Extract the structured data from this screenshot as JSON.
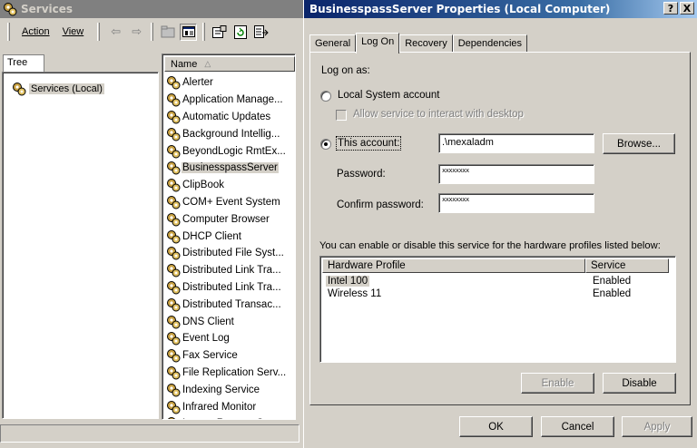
{
  "services_window": {
    "title": "Services",
    "menu": {
      "action": "Action",
      "view": "View"
    },
    "toolbar_icons": [
      "back-arrow-icon",
      "forward-arrow-icon",
      "up-folder-icon",
      "properties-grid-icon",
      "properties-icon",
      "refresh-icon",
      "export-icon"
    ],
    "tree_tab": "Tree",
    "tree_root": "Services (Local)",
    "list_header": "Name",
    "sort_glyph": "△",
    "services": [
      "Alerter",
      "Application Manage...",
      "Automatic Updates",
      "Background Intellig...",
      "BeyondLogic RmtEx...",
      "BusinesspassServer",
      "ClipBook",
      "COM+ Event System",
      "Computer Browser",
      "DHCP Client",
      "Distributed File Syst...",
      "Distributed Link Tra...",
      "Distributed Link Tra...",
      "Distributed Transac...",
      "DNS Client",
      "Event Log",
      "Fax Service",
      "File Replication Serv...",
      "Indexing Service",
      "Infrared Monitor",
      "Instant Remote Co..."
    ],
    "selected_service": "BusinesspassServer"
  },
  "dialog": {
    "title": "BusinesspassServer Properties (Local Computer)",
    "help_button": "?",
    "close_button": "X",
    "tabs": [
      "General",
      "Log On",
      "Recovery",
      "Dependencies"
    ],
    "active_tab": "Log On",
    "logon_as": "Log on as:",
    "local_system": "Local System account",
    "allow_interact": "Allow service to interact with desktop",
    "this_account": "This account:",
    "account_value": ".\\mexaladm",
    "browse": "Browse...",
    "password_label": "Password:",
    "password_value": "xxxxxxxx",
    "confirm_label": "Confirm password:",
    "confirm_value": "xxxxxxxx",
    "hw_note": "You can enable or disable this service for the hardware profiles listed below:",
    "hw_columns": [
      "Hardware Profile",
      "Service"
    ],
    "hw_rows": [
      {
        "profile": "Intel 100",
        "service": "Enabled"
      },
      {
        "profile": "Wireless 11",
        "service": "Enabled"
      }
    ],
    "enable": "Enable",
    "disable": "Disable",
    "ok": "OK",
    "cancel": "Cancel",
    "apply": "Apply"
  }
}
